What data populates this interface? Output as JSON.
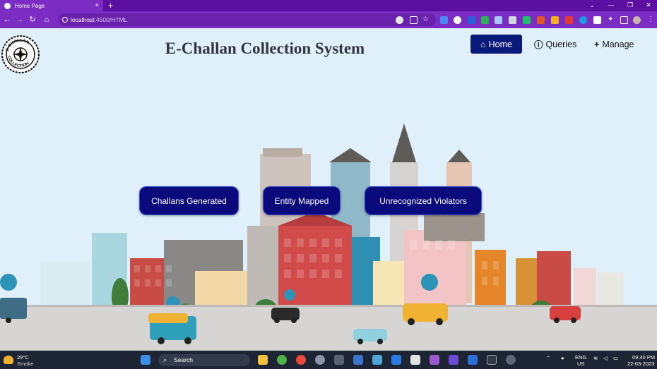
{
  "browser": {
    "tab_title": "Home Page",
    "tab_close": "×",
    "new_tab": "+",
    "url_host": "localhost",
    "url_path": ":4500/HTML",
    "win_controls": [
      "⌄",
      "—",
      "❐",
      "✕"
    ]
  },
  "header": {
    "logo_text": "E-CHALLAN COLLECTION",
    "title": "E-Challan Collection System",
    "nav": [
      {
        "label": "Home",
        "icon": "home-icon"
      },
      {
        "label": "Queries",
        "icon": "info-icon"
      },
      {
        "label": "Manage",
        "icon": "plus-icon"
      }
    ]
  },
  "buttons": {
    "challans": "Challans Generated",
    "entity": "Entity Mapped",
    "unrecognized": "Unrecognized Violators"
  },
  "taskbar": {
    "temperature": "29°C",
    "weather": "Smoke",
    "search_label": "Search",
    "lang_1": "ENG",
    "lang_2": "US",
    "time": "09:40 PM",
    "date": "22-03-2023"
  },
  "colors": {
    "accent": "#0a0a7d",
    "chrome": "#7b2cc2",
    "sky": "#dff0fb"
  }
}
